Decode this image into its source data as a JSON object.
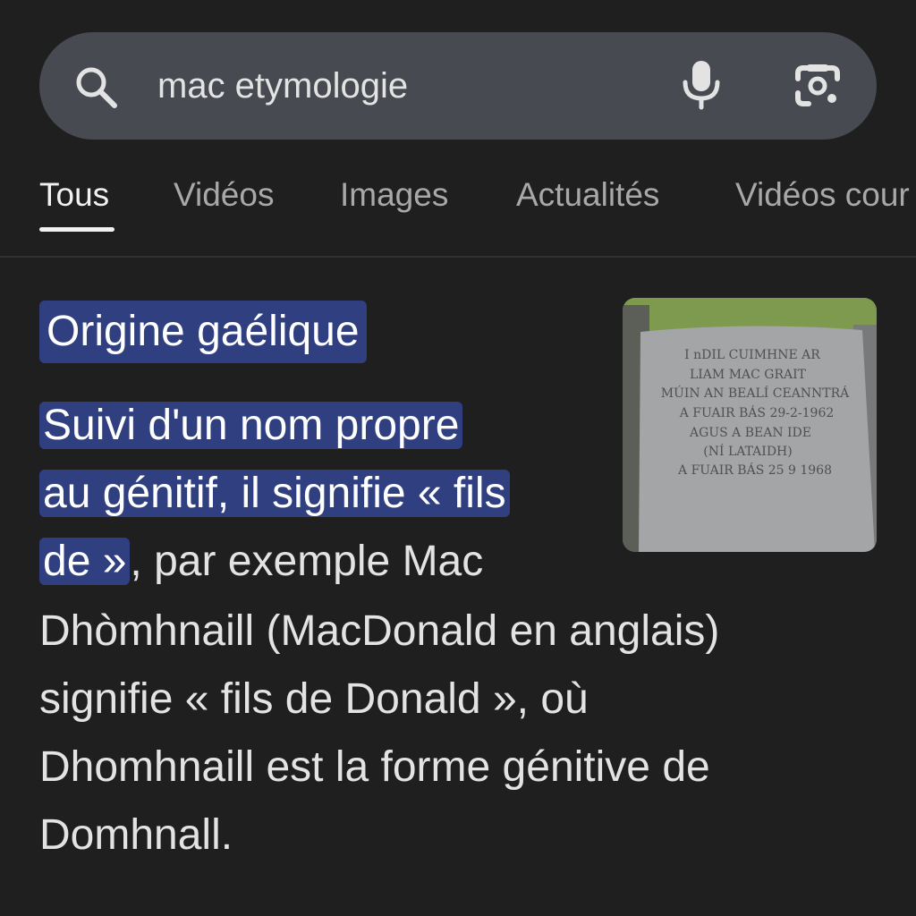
{
  "search": {
    "query": "mac etymologie"
  },
  "icons": {
    "search": "search-icon",
    "microphone": "microphone-icon",
    "lens": "google-lens-icon"
  },
  "tabs": [
    {
      "label": "Tous",
      "active": true
    },
    {
      "label": "Vidéos",
      "active": false
    },
    {
      "label": "Images",
      "active": false
    },
    {
      "label": "Actualités",
      "active": false
    },
    {
      "label": "Vidéos cour",
      "active": false
    }
  ],
  "result": {
    "title": "Origine gaélique",
    "snippet": {
      "highlight_line1": "Suivi d'un nom propre",
      "highlight_line2": "au génitif, il signifie « fils",
      "highlight_line3": "de »",
      "rest_line3": ", par exemple Mac",
      "line4": "Dhòmhnaill (MacDonald en anglais)",
      "line5": "signifie « fils de Donald », où",
      "line6": "Dhomhnaill est la forme génitive de",
      "line7": "Domhnall."
    },
    "thumbnail": {
      "inscription": [
        "I nDIL CUIMHNE AR",
        "LIAM MAC GRAIT",
        "MÚIN AN BEALÍ CEANNTRÁ",
        "A FUAIR BÁS 29-2-1962",
        "AGUS A BEAN IDE",
        "(NÍ LATAIDH)",
        "A FUAIR BÁS 25 9 1968"
      ]
    }
  },
  "colors": {
    "background": "#1f1f1f",
    "search_bar": "#474a50",
    "highlight": "#2f3f7f"
  }
}
